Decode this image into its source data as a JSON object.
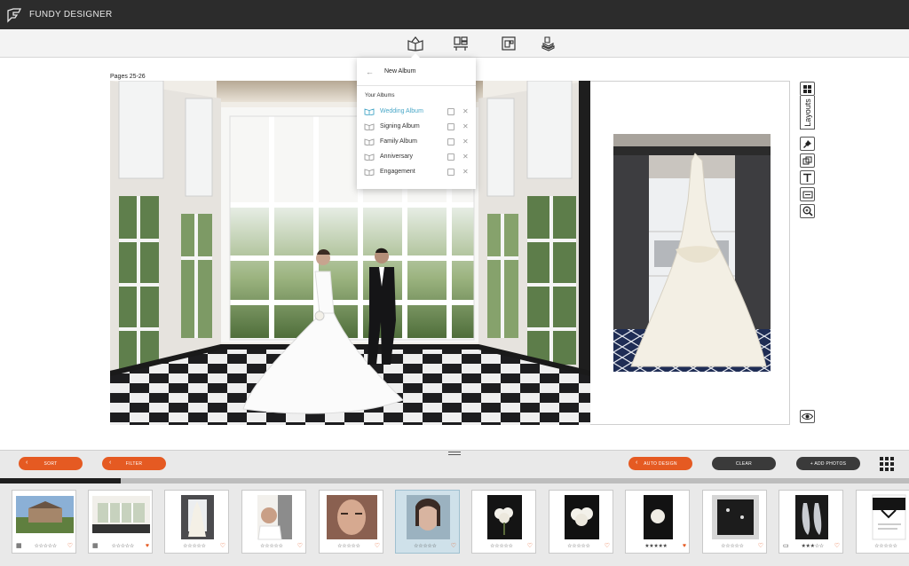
{
  "app": {
    "title": "FUNDY DESIGNER",
    "logo_icon": "fundy-logo-icon"
  },
  "toolbar": {
    "icons": [
      "album-icon",
      "layout-icon",
      "wall-icon",
      "stack-icon"
    ]
  },
  "spread": {
    "pages_label": "Pages 25-26"
  },
  "dropdown": {
    "new_album_label": "New Album",
    "your_albums_header": "Your Albums",
    "albums": [
      {
        "name": "Wedding Album",
        "active": true
      },
      {
        "name": "Signing Album",
        "active": false
      },
      {
        "name": "Family Album",
        "active": false
      },
      {
        "name": "Anniversary",
        "active": false
      },
      {
        "name": "Engagement",
        "active": false
      }
    ]
  },
  "right_tools": {
    "layouts_label": "Layouts",
    "icons": [
      "grid-icon",
      "pin-icon",
      "copy-icon",
      "text-icon",
      "fit-icon",
      "zoom-icon",
      "eye-icon"
    ]
  },
  "bottombar": {
    "sort_label": "SORT",
    "filter_label": "FILTER",
    "auto_design_label": "AUTO DESIGN",
    "clear_label": "CLEAR",
    "add_photos_label": "+ ADD PHOTOS"
  },
  "progress": {
    "fraction": 0.133
  },
  "filmstrip": {
    "thumbs": [
      {
        "stars": "☆☆☆☆☆",
        "heart": "♡",
        "used": true,
        "selected": false
      },
      {
        "stars": "☆☆☆☆☆",
        "heart": "♥",
        "used": true,
        "selected": false
      },
      {
        "stars": "☆☆☆☆☆",
        "heart": "♡",
        "used": false,
        "selected": false
      },
      {
        "stars": "☆☆☆☆☆",
        "heart": "♡",
        "used": false,
        "selected": false
      },
      {
        "stars": "☆☆☆☆☆",
        "heart": "♡",
        "used": false,
        "selected": false
      },
      {
        "stars": "☆☆☆☆☆",
        "heart": "♡",
        "used": false,
        "selected": true
      },
      {
        "stars": "☆☆☆☆☆",
        "heart": "♡",
        "used": false,
        "selected": false
      },
      {
        "stars": "☆☆☆☆☆",
        "heart": "♡",
        "used": false,
        "selected": false
      },
      {
        "stars": "★★★★★",
        "heart": "♥",
        "used": false,
        "selected": false
      },
      {
        "stars": "☆☆☆☆☆",
        "heart": "♡",
        "used": false,
        "selected": false
      },
      {
        "stars": "★★★☆☆",
        "heart": "♡",
        "used": true,
        "selected": false
      },
      {
        "stars": "☆☆☆☆☆",
        "heart": "♡",
        "used": false,
        "selected": false
      }
    ]
  },
  "colors": {
    "accent": "#e55a22",
    "highlight": "#4aa8c8",
    "titlebar": "#2c2c2c"
  }
}
